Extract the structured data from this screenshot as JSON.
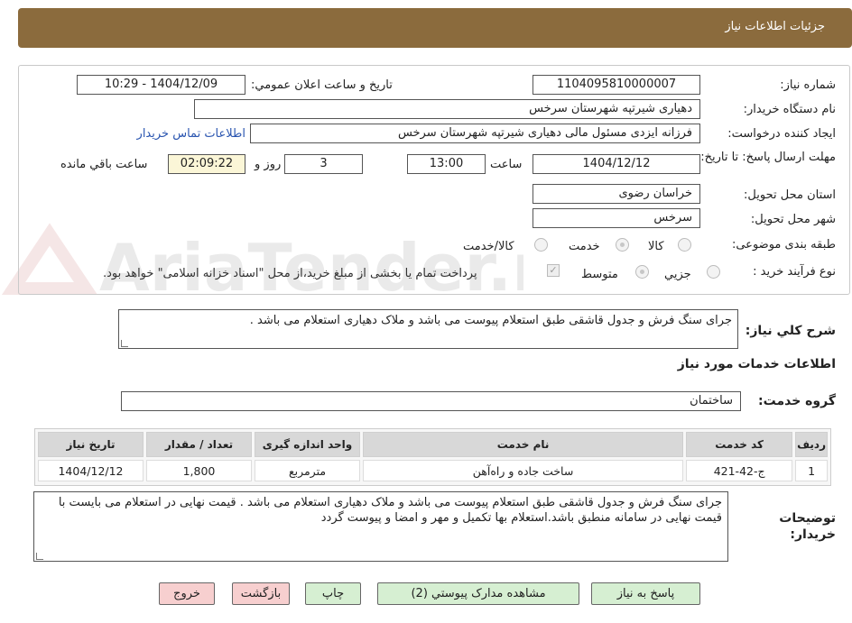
{
  "header": {
    "title": "جزئيات اطلاعات نياز"
  },
  "form": {
    "need_number_label": "شماره نياز:",
    "need_number": "1104095810000007",
    "announce_label": "تاريخ و ساعت اعلان عمومي:",
    "announce_value": "1404/12/09 - 10:29",
    "buyer_org_label": "نام دستگاه خريدار:",
    "buyer_org": "دهیاری شیرتپه شهرستان سرخس",
    "requester_label": "ايجاد کننده درخواست:",
    "requester": "فرزانه ایزدی مسئول مالی دهیاری شیرتپه شهرستان سرخس",
    "contact_link": "اطلاعات تماس خريدار",
    "deadline_label": "مهلت ارسال پاسخ: تا تاريخ:",
    "deadline_date": "1404/12/12",
    "time_label": "ساعت",
    "deadline_time": "13:00",
    "days_value": "3",
    "days_label": "روز و",
    "remaining_time": "02:09:22",
    "remaining_label": "ساعت باقي مانده",
    "province_label": "استان محل تحویل:",
    "province": "خراسان رضوی",
    "city_label": "شهر محل تحویل:",
    "city": "سرخس",
    "category_label": "طبقه بندی موضوعی:",
    "category_options": [
      "کالا",
      "خدمت",
      "کالا/خدمت"
    ],
    "category_selected": "خدمت",
    "process_label": "نوع فرآیند خرید :",
    "process_options": [
      "جزيي",
      "متوسط"
    ],
    "process_selected": "متوسط",
    "payment_note": "پرداخت تمام یا بخشی از مبلغ خرید،از محل \"اسناد خزانه اسلامی\" خواهد بود.",
    "description_label": "شرح کلي نياز:",
    "description": "جرای  سنگ فرش و جدول قاشقی طبق استعلام پیوست  می باشد و ملاک دهیاری استعلام می باشد ."
  },
  "services": {
    "section_title": "اطلاعات خدمات مورد نياز",
    "group_label": "گروه خدمت:",
    "group_value": "ساختمان",
    "columns": [
      "رديف",
      "کد خدمت",
      "نام خدمت",
      "واحد اندازه گیری",
      "تعداد / مقدار",
      "تاريخ نياز"
    ],
    "rows": [
      [
        "1",
        "ج-42-421",
        "ساخت جاده و راه‌آهن",
        "مترمربع",
        "1,800",
        "1404/12/12"
      ]
    ]
  },
  "buyer_notes": {
    "label": "توضيحات خريدار:",
    "text": "جرای  سنگ فرش  و جدول قاشقی طبق استعلام پیوست  می باشد و ملاک دهیاری استعلام می باشد . قیمت نهایی در استعلام می بایست با قیمت نهایی در سامانه منطبق باشد.استعلام بها تکمیل و مهر و امضا و پیوست گردد"
  },
  "buttons": {
    "reply": "پاسخ به نياز",
    "attachments": "مشاهده مدارک پيوستي (2)",
    "print": "چاپ",
    "back": "بازگشت",
    "exit": "خروج"
  },
  "watermark": {
    "text": "AriaTender.neT"
  },
  "colors": {
    "header_bg": "#8b6b3d",
    "button_green": "#d6efd2",
    "button_pink": "#f7cfcf",
    "link": "#2a55b0"
  }
}
